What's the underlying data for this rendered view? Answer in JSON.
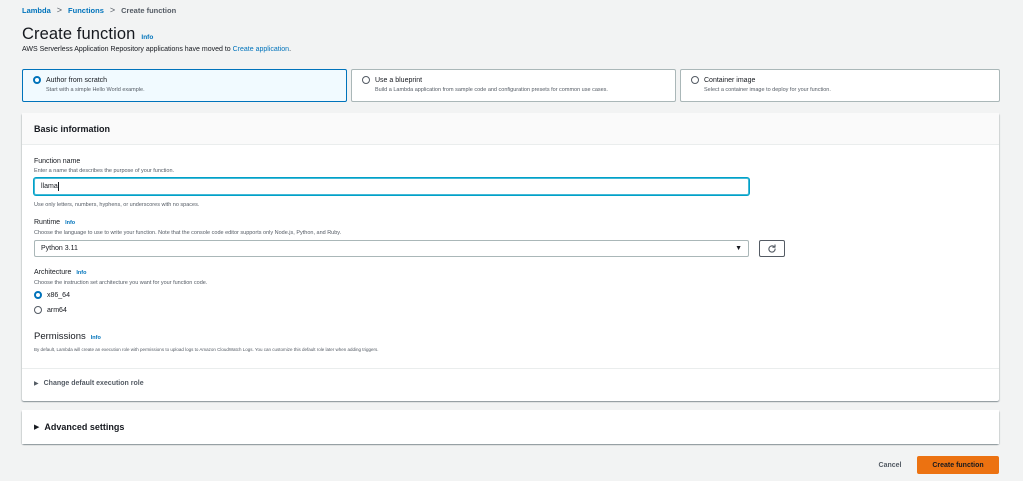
{
  "breadcrumb": {
    "items": [
      "Lambda",
      "Functions",
      "Create function"
    ],
    "separator": ">"
  },
  "header": {
    "title": "Create function",
    "info": "Info",
    "subtitle_prefix": "AWS Serverless Application Repository applications have moved to ",
    "subtitle_link": "Create application",
    "subtitle_suffix": "."
  },
  "options": [
    {
      "label": "Author from scratch",
      "description": "Start with a simple Hello World example.",
      "selected": true
    },
    {
      "label": "Use a blueprint",
      "description": "Build a Lambda application from sample code and configuration presets for common use cases.",
      "selected": false
    },
    {
      "label": "Container image",
      "description": "Select a container image to deploy for your function.",
      "selected": false
    }
  ],
  "basic": {
    "title": "Basic information",
    "function_name": {
      "label": "Function name",
      "description": "Enter a name that describes the purpose of your function.",
      "value": "llama",
      "constraint": "Use only letters, numbers, hyphens, or underscores with no spaces."
    },
    "runtime": {
      "label": "Runtime",
      "info": "Info",
      "description": "Choose the language to use to write your function. Note that the console code editor supports only Node.js, Python, and Ruby.",
      "value": "Python 3.11"
    },
    "architecture": {
      "label": "Architecture",
      "info": "Info",
      "description": "Choose the instruction set architecture you want for your function code.",
      "options": [
        "x86_64",
        "arm64"
      ],
      "selected": "x86_64"
    },
    "permissions": {
      "title": "Permissions",
      "info": "Info",
      "description": "By default, Lambda will create an execution role with permissions to upload logs to Amazon CloudWatch Logs. You can customize this default role later when adding triggers."
    },
    "change_role": "Change default execution role"
  },
  "advanced": {
    "title": "Advanced settings"
  },
  "footer": {
    "cancel": "Cancel",
    "create": "Create function"
  },
  "colors": {
    "link": "#0073bb",
    "primary_button": "#ec7211",
    "selected_tile_bg": "#f1faff",
    "background": "#f2f3f3"
  }
}
